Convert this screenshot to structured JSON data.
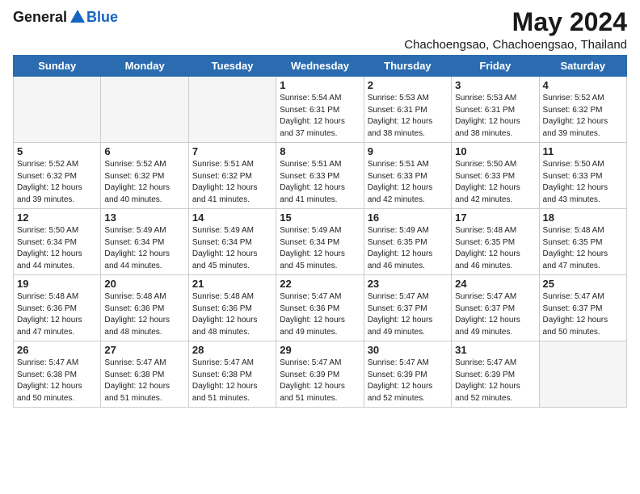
{
  "logo": {
    "general": "General",
    "blue": "Blue"
  },
  "title": {
    "month_year": "May 2024",
    "location": "Chachoengsao, Chachoengsao, Thailand"
  },
  "weekdays": [
    "Sunday",
    "Monday",
    "Tuesday",
    "Wednesday",
    "Thursday",
    "Friday",
    "Saturday"
  ],
  "weeks": [
    [
      {
        "day": "",
        "empty": true
      },
      {
        "day": "",
        "empty": true
      },
      {
        "day": "",
        "empty": true
      },
      {
        "day": "1",
        "sunrise": "5:54 AM",
        "sunset": "6:31 PM",
        "daylight": "12 hours and 37 minutes."
      },
      {
        "day": "2",
        "sunrise": "5:53 AM",
        "sunset": "6:31 PM",
        "daylight": "12 hours and 38 minutes."
      },
      {
        "day": "3",
        "sunrise": "5:53 AM",
        "sunset": "6:31 PM",
        "daylight": "12 hours and 38 minutes."
      },
      {
        "day": "4",
        "sunrise": "5:52 AM",
        "sunset": "6:32 PM",
        "daylight": "12 hours and 39 minutes."
      }
    ],
    [
      {
        "day": "5",
        "sunrise": "5:52 AM",
        "sunset": "6:32 PM",
        "daylight": "12 hours and 39 minutes."
      },
      {
        "day": "6",
        "sunrise": "5:52 AM",
        "sunset": "6:32 PM",
        "daylight": "12 hours and 40 minutes."
      },
      {
        "day": "7",
        "sunrise": "5:51 AM",
        "sunset": "6:32 PM",
        "daylight": "12 hours and 41 minutes."
      },
      {
        "day": "8",
        "sunrise": "5:51 AM",
        "sunset": "6:33 PM",
        "daylight": "12 hours and 41 minutes."
      },
      {
        "day": "9",
        "sunrise": "5:51 AM",
        "sunset": "6:33 PM",
        "daylight": "12 hours and 42 minutes."
      },
      {
        "day": "10",
        "sunrise": "5:50 AM",
        "sunset": "6:33 PM",
        "daylight": "12 hours and 42 minutes."
      },
      {
        "day": "11",
        "sunrise": "5:50 AM",
        "sunset": "6:33 PM",
        "daylight": "12 hours and 43 minutes."
      }
    ],
    [
      {
        "day": "12",
        "sunrise": "5:50 AM",
        "sunset": "6:34 PM",
        "daylight": "12 hours and 44 minutes."
      },
      {
        "day": "13",
        "sunrise": "5:49 AM",
        "sunset": "6:34 PM",
        "daylight": "12 hours and 44 minutes."
      },
      {
        "day": "14",
        "sunrise": "5:49 AM",
        "sunset": "6:34 PM",
        "daylight": "12 hours and 45 minutes."
      },
      {
        "day": "15",
        "sunrise": "5:49 AM",
        "sunset": "6:34 PM",
        "daylight": "12 hours and 45 minutes."
      },
      {
        "day": "16",
        "sunrise": "5:49 AM",
        "sunset": "6:35 PM",
        "daylight": "12 hours and 46 minutes."
      },
      {
        "day": "17",
        "sunrise": "5:48 AM",
        "sunset": "6:35 PM",
        "daylight": "12 hours and 46 minutes."
      },
      {
        "day": "18",
        "sunrise": "5:48 AM",
        "sunset": "6:35 PM",
        "daylight": "12 hours and 47 minutes."
      }
    ],
    [
      {
        "day": "19",
        "sunrise": "5:48 AM",
        "sunset": "6:36 PM",
        "daylight": "12 hours and 47 minutes."
      },
      {
        "day": "20",
        "sunrise": "5:48 AM",
        "sunset": "6:36 PM",
        "daylight": "12 hours and 48 minutes."
      },
      {
        "day": "21",
        "sunrise": "5:48 AM",
        "sunset": "6:36 PM",
        "daylight": "12 hours and 48 minutes."
      },
      {
        "day": "22",
        "sunrise": "5:47 AM",
        "sunset": "6:36 PM",
        "daylight": "12 hours and 49 minutes."
      },
      {
        "day": "23",
        "sunrise": "5:47 AM",
        "sunset": "6:37 PM",
        "daylight": "12 hours and 49 minutes."
      },
      {
        "day": "24",
        "sunrise": "5:47 AM",
        "sunset": "6:37 PM",
        "daylight": "12 hours and 49 minutes."
      },
      {
        "day": "25",
        "sunrise": "5:47 AM",
        "sunset": "6:37 PM",
        "daylight": "12 hours and 50 minutes."
      }
    ],
    [
      {
        "day": "26",
        "sunrise": "5:47 AM",
        "sunset": "6:38 PM",
        "daylight": "12 hours and 50 minutes."
      },
      {
        "day": "27",
        "sunrise": "5:47 AM",
        "sunset": "6:38 PM",
        "daylight": "12 hours and 51 minutes."
      },
      {
        "day": "28",
        "sunrise": "5:47 AM",
        "sunset": "6:38 PM",
        "daylight": "12 hours and 51 minutes."
      },
      {
        "day": "29",
        "sunrise": "5:47 AM",
        "sunset": "6:39 PM",
        "daylight": "12 hours and 51 minutes."
      },
      {
        "day": "30",
        "sunrise": "5:47 AM",
        "sunset": "6:39 PM",
        "daylight": "12 hours and 52 minutes."
      },
      {
        "day": "31",
        "sunrise": "5:47 AM",
        "sunset": "6:39 PM",
        "daylight": "12 hours and 52 minutes."
      },
      {
        "day": "",
        "empty": true
      }
    ]
  ]
}
